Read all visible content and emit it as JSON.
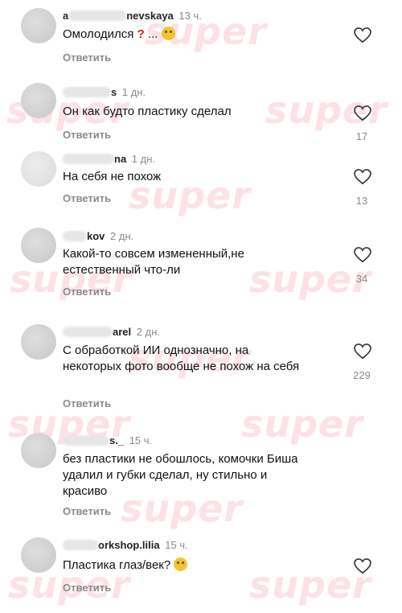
{
  "watermark": "super",
  "reply_label": "Ответить",
  "comments": [
    {
      "user": "a",
      "user2": "nevskaya",
      "age": "13 ч.",
      "text": "Омолодился",
      "suffix": " ...",
      "likes": ""
    },
    {
      "user": "",
      "user2": "s",
      "age": "1 дн.",
      "text": "Он как будто пластику сделал",
      "likes": "17"
    },
    {
      "user": "",
      "user2": "na",
      "age": "1 дн.",
      "text": "На себя не похож",
      "likes": "13"
    },
    {
      "user": "",
      "user2": "kov",
      "age": "2 дн.",
      "text": "Какой-то совсем измененный,не естественный что-ли",
      "likes": "34"
    },
    {
      "user": "",
      "user2": "arel",
      "age": "2 дн.",
      "text": "С обработкой ИИ однозначно, на некоторых фото вообще не похож на себя",
      "likes": "229"
    },
    {
      "user": "",
      "user2": "s._",
      "age": "15 ч.",
      "text": "без пластики не обошлось, комочки Биша удалил и губки сделал, ну стильно и красиво",
      "likes": ""
    },
    {
      "user": "",
      "user2": "orkshop.lilia",
      "age": "15 ч.",
      "text": "Пластика глаз/век?",
      "likes": ""
    }
  ],
  "colors": {
    "watermark": "#f0788c",
    "meta": "#8a8a8a"
  },
  "icons": {
    "like": "heart-outline-icon",
    "emoji": "thinking-face-emoji",
    "question": "red-question-mark"
  }
}
